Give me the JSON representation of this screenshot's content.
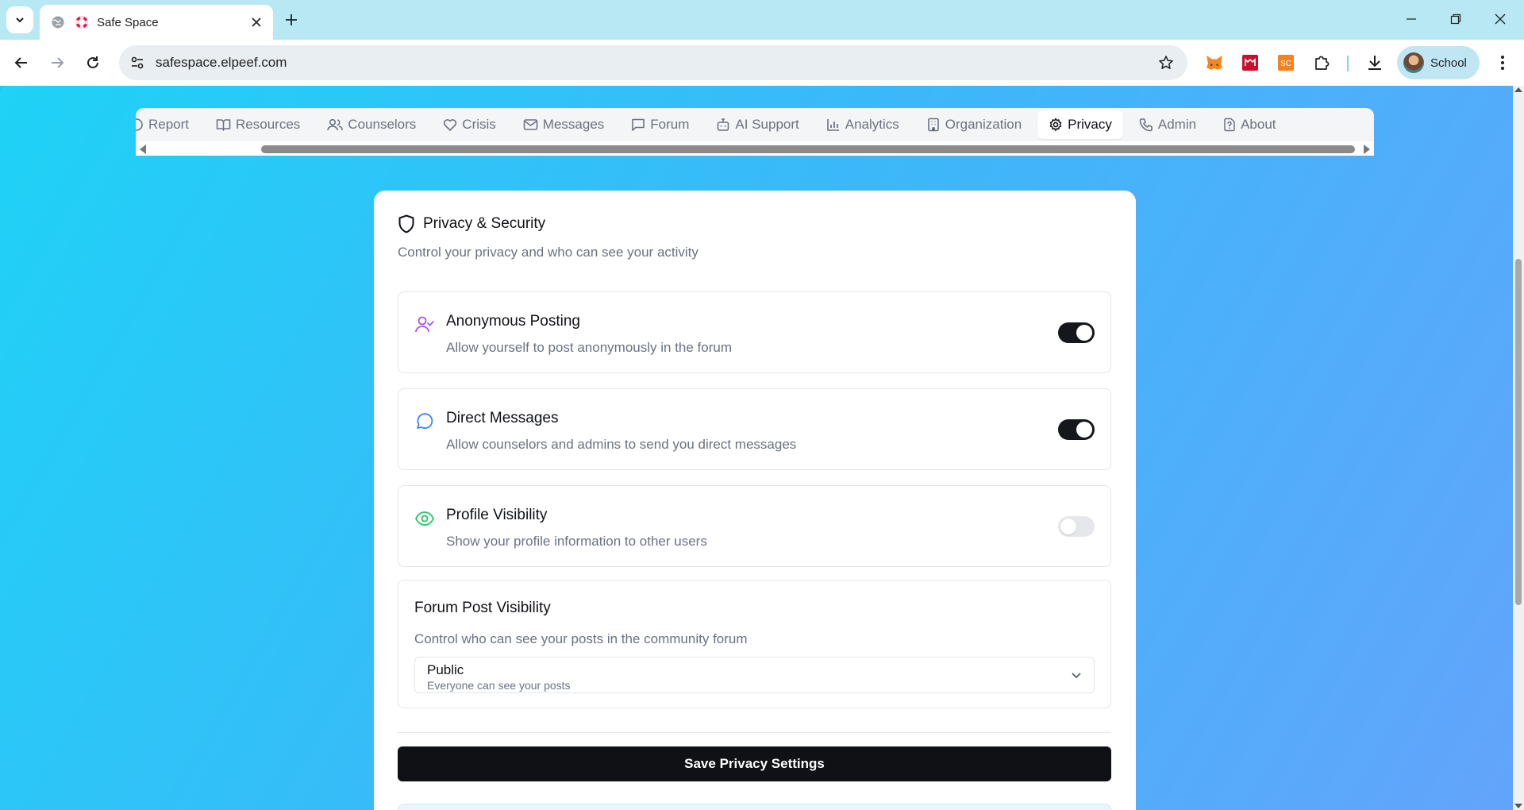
{
  "browser": {
    "tab_title": "Safe Space",
    "url": "safespace.elpeef.com",
    "profile_name": "School"
  },
  "nav": {
    "tabs": [
      {
        "label": "Report",
        "icon": "report-icon"
      },
      {
        "label": "Resources",
        "icon": "book-icon"
      },
      {
        "label": "Counselors",
        "icon": "users-icon"
      },
      {
        "label": "Crisis",
        "icon": "heart-icon"
      },
      {
        "label": "Messages",
        "icon": "mail-icon"
      },
      {
        "label": "Forum",
        "icon": "chat-icon"
      },
      {
        "label": "AI Support",
        "icon": "bot-icon"
      },
      {
        "label": "Analytics",
        "icon": "bar-chart-icon"
      },
      {
        "label": "Organization",
        "icon": "building-icon"
      },
      {
        "label": "Privacy",
        "icon": "gear-icon",
        "active": true
      },
      {
        "label": "Admin",
        "icon": "phone-icon"
      },
      {
        "label": "About",
        "icon": "help-icon"
      }
    ]
  },
  "privacy": {
    "title": "Privacy & Security",
    "subtitle": "Control your privacy and who can see your activity",
    "settings": [
      {
        "name": "Anonymous Posting",
        "desc": "Allow yourself to post anonymously in the forum",
        "enabled": true,
        "icon_color": "#a855f7"
      },
      {
        "name": "Direct Messages",
        "desc": "Allow counselors and admins to send you direct messages",
        "enabled": true,
        "icon_color": "#3b82f6"
      },
      {
        "name": "Profile Visibility",
        "desc": "Show your profile information to other users",
        "enabled": false,
        "icon_color": "#22c55e"
      }
    ],
    "forum": {
      "title": "Forum Post Visibility",
      "desc": "Control who can see your posts in the community forum",
      "selected": "Public",
      "selected_desc": "Everyone can see your posts"
    },
    "save_label": "Save Privacy Settings"
  }
}
